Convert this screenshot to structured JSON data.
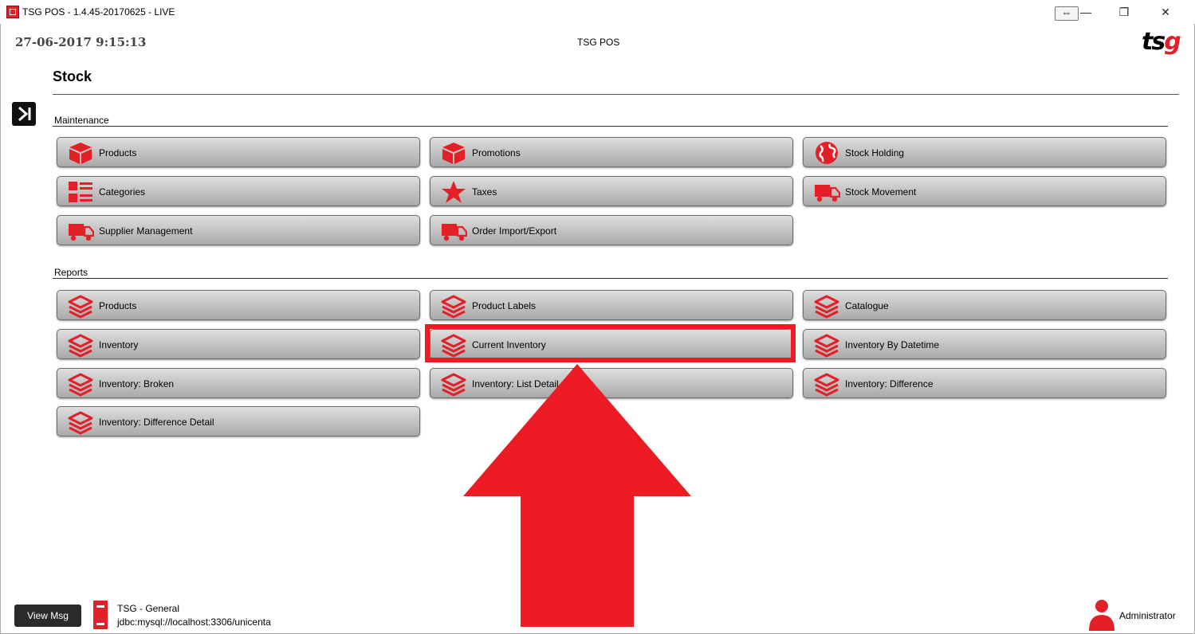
{
  "window": {
    "title": "TSG POS - 1.4.45-20170625 - LIVE",
    "controls": {
      "minimize": "—",
      "maximize": "❐",
      "close": "✕",
      "resize": "⇔"
    }
  },
  "header": {
    "datetime": "27-06-2017 9:15:13",
    "app_title": "TSG POS",
    "logo_ts": "ts",
    "logo_g": "g"
  },
  "page": {
    "title": "Stock"
  },
  "maintenance": {
    "label": "Maintenance",
    "items": [
      {
        "label": "Products",
        "icon": "box-icon"
      },
      {
        "label": "Promotions",
        "icon": "box-icon"
      },
      {
        "label": "Stock Holding",
        "icon": "globe-icon"
      },
      {
        "label": "Categories",
        "icon": "category-list-icon"
      },
      {
        "label": "Taxes",
        "icon": "star-icon"
      },
      {
        "label": "Stock Movement",
        "icon": "truck-icon"
      },
      {
        "label": "Supplier Management",
        "icon": "truck-icon"
      },
      {
        "label": "Order Import/Export",
        "icon": "truck-icon"
      }
    ]
  },
  "reports": {
    "label": "Reports",
    "items": [
      {
        "label": "Products",
        "icon": "layers-icon"
      },
      {
        "label": "Product Labels",
        "icon": "layers-icon"
      },
      {
        "label": "Catalogue",
        "icon": "layers-icon"
      },
      {
        "label": "Inventory",
        "icon": "layers-icon"
      },
      {
        "label": "Current Inventory",
        "icon": "layers-icon",
        "highlighted": true
      },
      {
        "label": "Inventory By Datetime",
        "icon": "layers-icon"
      },
      {
        "label": "Inventory: Broken",
        "icon": "layers-icon"
      },
      {
        "label": "Inventory: List Detail",
        "icon": "layers-icon"
      },
      {
        "label": "Inventory: Difference",
        "icon": "layers-icon"
      },
      {
        "label": "Inventory: Difference Detail",
        "icon": "layers-icon"
      }
    ]
  },
  "footer": {
    "view_msg": "View Msg",
    "db_name": "TSG - General",
    "db_url": "jdbc:mysql://localhost:3306/unicenta",
    "user": "Administrator"
  },
  "colors": {
    "accent": "#e32028",
    "highlight": "#ed1c24"
  }
}
